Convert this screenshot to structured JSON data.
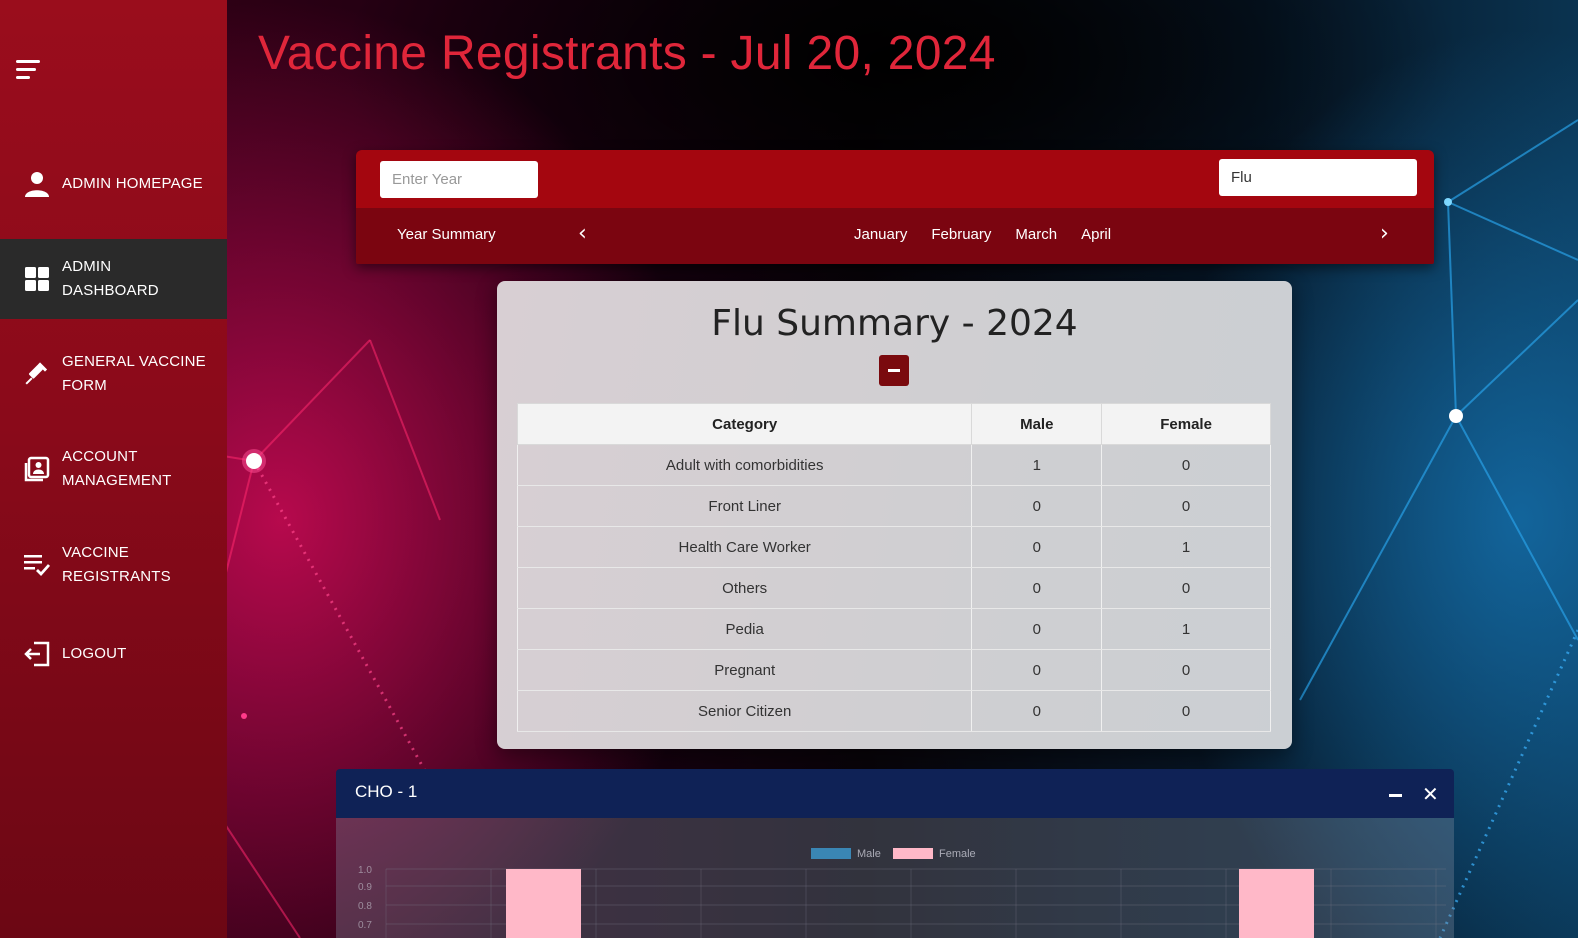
{
  "title": "Vaccine Registrants - Jul 20, 2024",
  "sidebar": {
    "items": [
      {
        "label": "ADMIN HOMEPAGE",
        "icon": "user-icon"
      },
      {
        "label": "ADMIN DASHBOARD",
        "icon": "dashboard-grid-icon",
        "active": true
      },
      {
        "label": "GENERAL VACCINE FORM",
        "icon": "syringe-icon"
      },
      {
        "label": "ACCOUNT MANAGEMENT",
        "icon": "account-card-icon"
      },
      {
        "label": "VACCINE REGISTRANTS",
        "icon": "list-check-icon"
      },
      {
        "label": "LOGOUT",
        "icon": "logout-icon"
      }
    ]
  },
  "filters": {
    "year_placeholder": "Enter Year",
    "vaccine_selected": "Flu",
    "year_summary_label": "Year Summary",
    "months": [
      "January",
      "February",
      "March",
      "April"
    ]
  },
  "summary": {
    "title": "Flu Summary - 2024",
    "columns": [
      "Category",
      "Male",
      "Female"
    ],
    "rows": [
      [
        "Adult with comorbidities",
        "1",
        "0"
      ],
      [
        "Front Liner",
        "0",
        "0"
      ],
      [
        "Health Care Worker",
        "0",
        "1"
      ],
      [
        "Others",
        "0",
        "0"
      ],
      [
        "Pedia",
        "0",
        "1"
      ],
      [
        "Pregnant",
        "0",
        "0"
      ],
      [
        "Senior Citizen",
        "0",
        "0"
      ]
    ]
  },
  "chart_panel": {
    "title": "CHO - 1"
  },
  "chart_data": {
    "type": "bar",
    "series": [
      {
        "name": "Male",
        "color": "#3a86b4",
        "values": [
          0,
          0
        ]
      },
      {
        "name": "Female",
        "color": "#ffb8c8",
        "values": [
          1,
          1
        ]
      }
    ],
    "y_ticks": [
      "1.0",
      "0.9",
      "0.8",
      "0.7"
    ],
    "ylim": [
      0,
      1
    ],
    "legend": "top-center"
  },
  "colors": {
    "sidebar": "#9a0d1c",
    "title": "#e0263a",
    "filter_bar": "#a4060f",
    "chart_header": "#0f2256"
  }
}
